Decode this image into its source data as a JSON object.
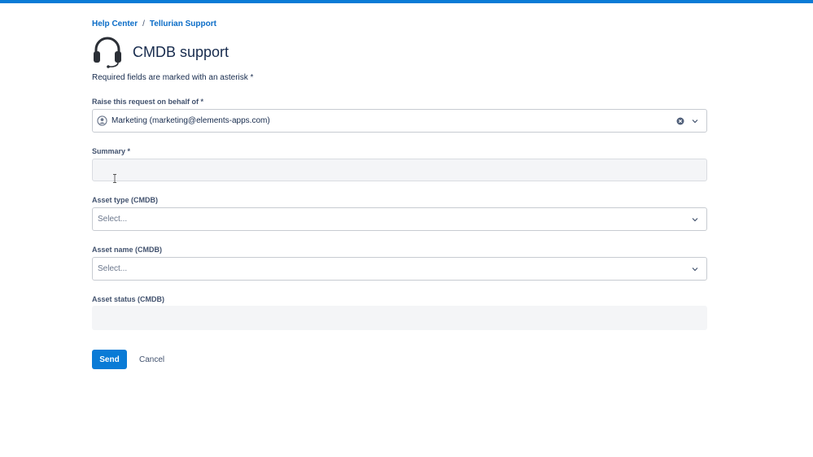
{
  "breadcrumb": {
    "items": [
      "Help Center",
      "Tellurian Support"
    ],
    "separator": "/"
  },
  "header": {
    "title": "CMDB support",
    "icon": "headset-icon"
  },
  "required_note": "Required fields are marked with an asterisk *",
  "form": {
    "on_behalf": {
      "label": "Raise this request on behalf of *",
      "value": "Marketing (marketing@elements-apps.com)"
    },
    "summary": {
      "label": "Summary *",
      "value": ""
    },
    "asset_type": {
      "label": "Asset type (CMDB)",
      "placeholder": "Select..."
    },
    "asset_name": {
      "label": "Asset name (CMDB)",
      "placeholder": "Select..."
    },
    "asset_status": {
      "label": "Asset status (CMDB)",
      "value": ""
    }
  },
  "actions": {
    "send_label": "Send",
    "cancel_label": "Cancel"
  },
  "colors": {
    "accent": "#0a7bd6",
    "link": "#0a6cc7",
    "text": "#172b4d",
    "muted": "#42526e"
  }
}
